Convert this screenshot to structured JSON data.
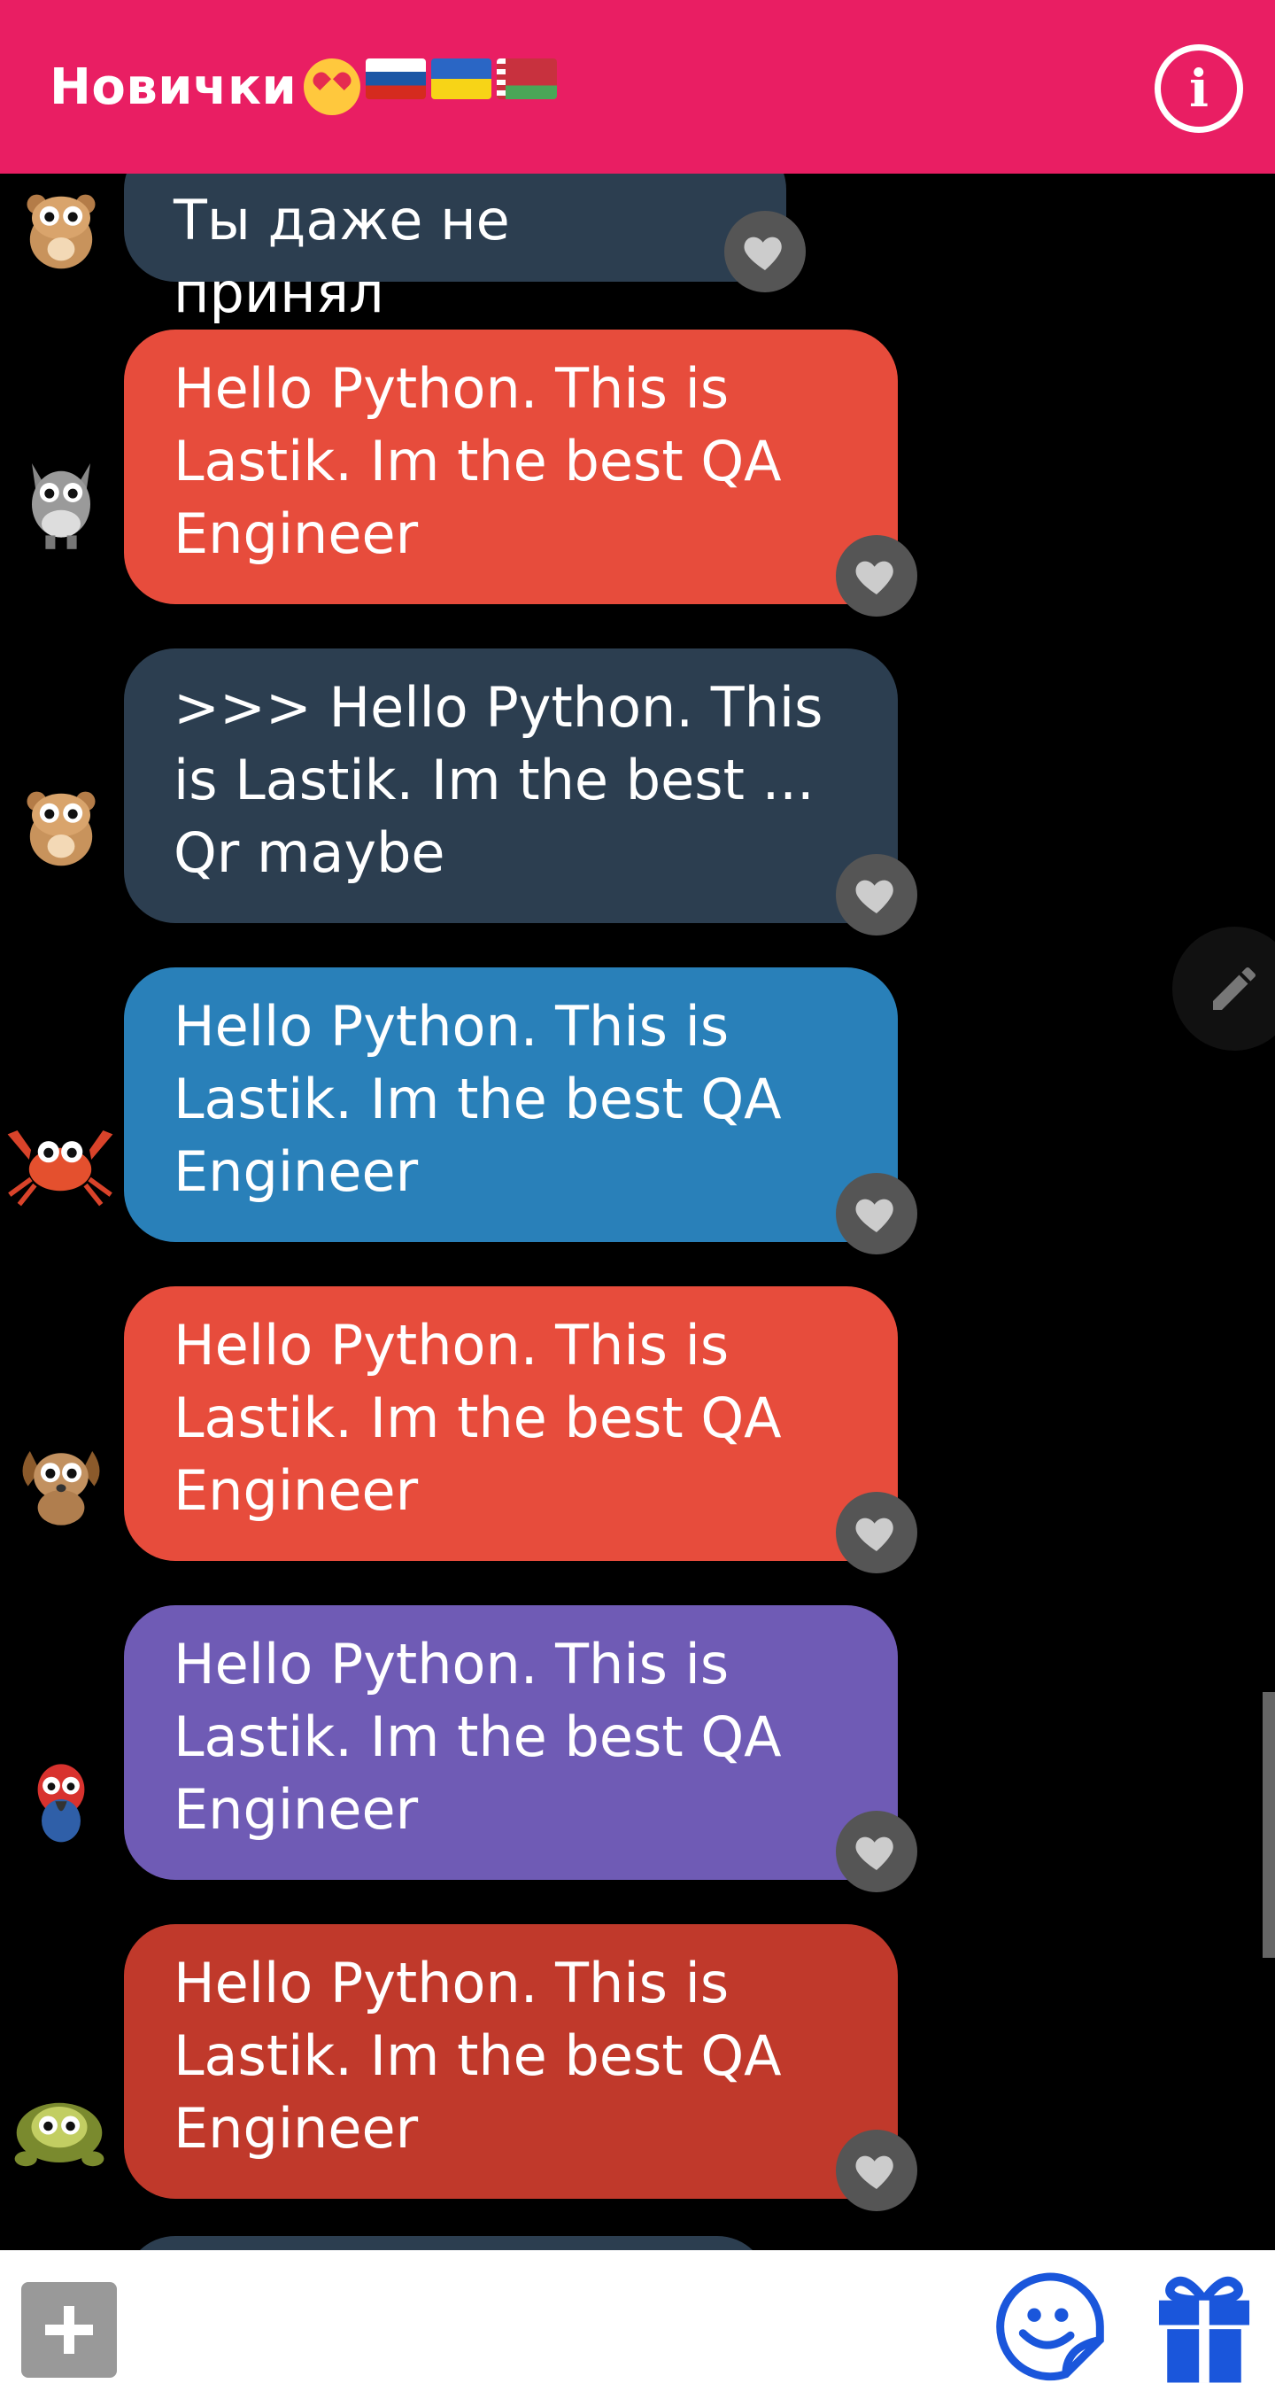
{
  "header": {
    "title": "Новички",
    "emojis": [
      "heart-eyes-emoji",
      "russia-flag",
      "ukraine-flag",
      "belarus-flag"
    ],
    "info_icon": "info-icon",
    "color": "#E91E63"
  },
  "messages": [
    {
      "avatar": "hamster-avatar",
      "text": "Ты даже не принял",
      "color": "#2C3E50"
    },
    {
      "avatar": "donkey-avatar",
      "text": "Hello Python. This is Lastik. Im the best QA Engineer",
      "color": "#E74C3C"
    },
    {
      "avatar": "hamster-avatar",
      "text": ">>> Hello Python. This is Lastik. Im the best ... Qr maybe",
      "color": "#2C3E50"
    },
    {
      "avatar": "crab-avatar",
      "text": "Hello Python. This is Lastik. Im the best QA Engineer",
      "color": "#2980B9"
    },
    {
      "avatar": "dog-avatar",
      "text": "Hello Python. This is Lastik. Im the best QA Engineer",
      "color": "#E74C3C"
    },
    {
      "avatar": "parrot-avatar",
      "text": "Hello Python. This is Lastik. Im the best QA Engineer",
      "color": "#6F5BB5"
    },
    {
      "avatar": "turtle-avatar",
      "text": "Hello Python. This is Lastik. Im the best QA Engineer",
      "color": "#C0392B"
    }
  ],
  "like_icon": "heart-icon",
  "edit_icon": "pencil-icon",
  "bottom_bar": {
    "add_icon": "plus-icon",
    "sticker_icon": "sticker-icon",
    "gift_icon": "gift-icon",
    "accent": "#1A56DB"
  }
}
